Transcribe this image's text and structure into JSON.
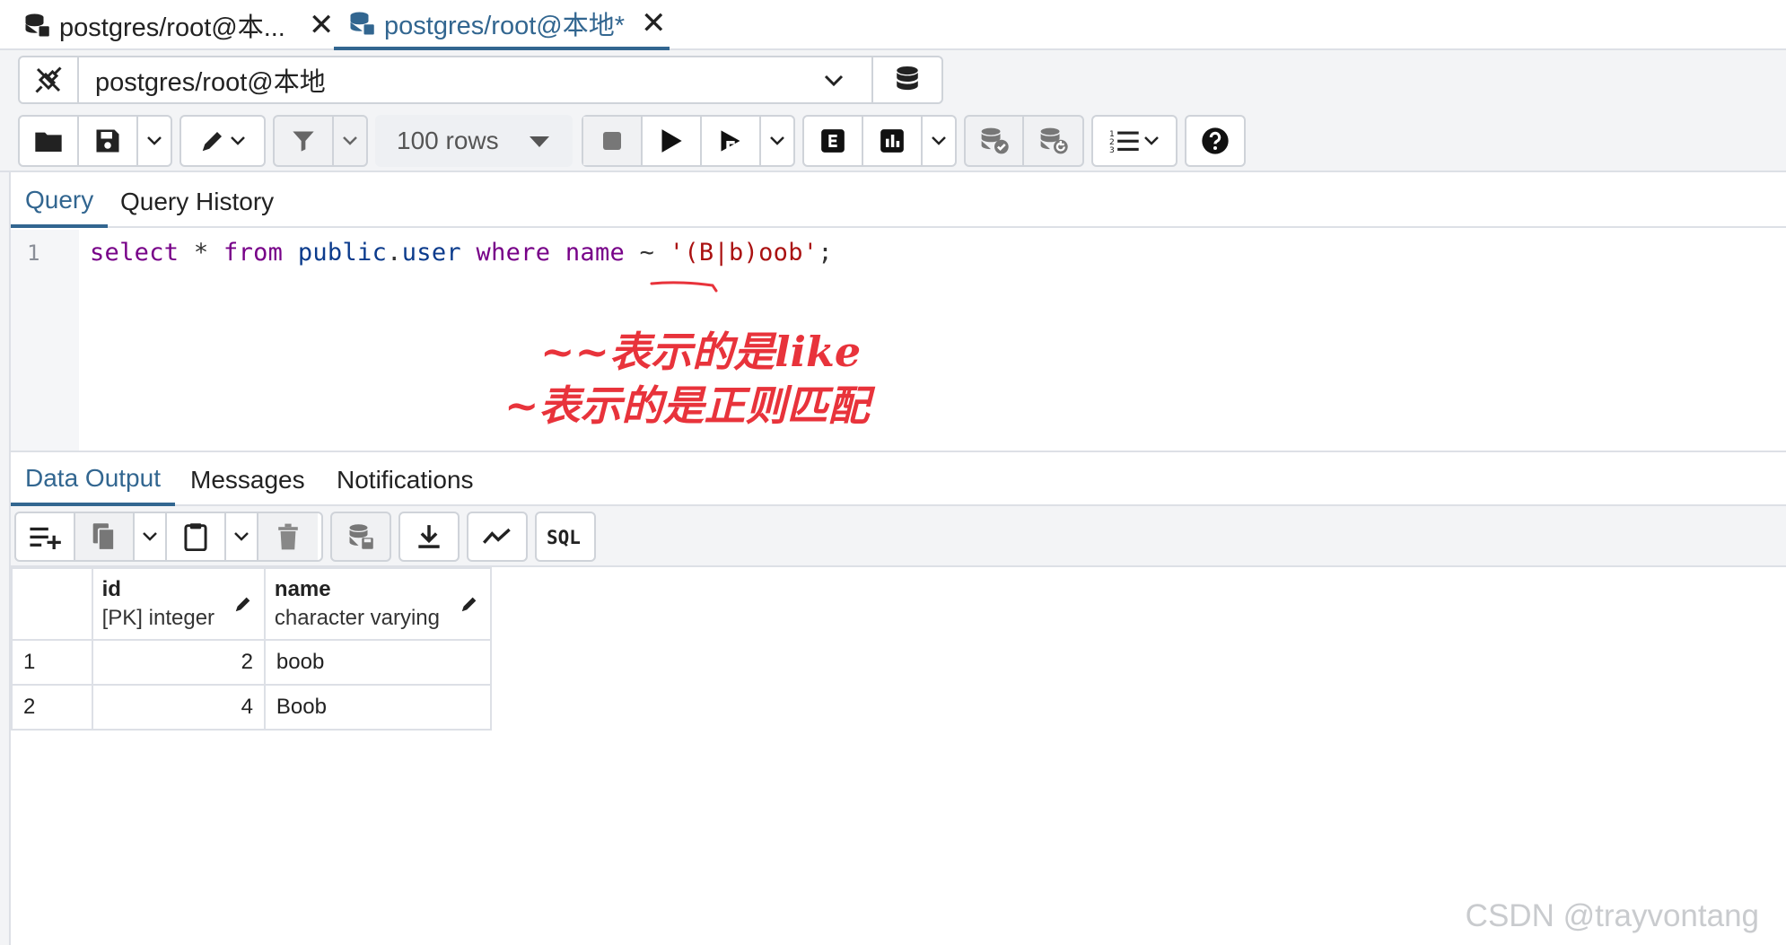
{
  "editor_tabs": [
    {
      "label": "postgres/root@本...",
      "active": false
    },
    {
      "label": "postgres/root@本地*",
      "active": true
    }
  ],
  "connection": {
    "selected": "postgres/root@本地"
  },
  "toolbar": {
    "rows_limit": "100 rows"
  },
  "query_tabs": [
    {
      "label": "Query",
      "active": true
    },
    {
      "label": "Query History",
      "active": false
    }
  ],
  "editor": {
    "line_number": "1",
    "tokens": {
      "select": "select",
      "star": " * ",
      "from": "from",
      "schema": "public",
      "dot": ".",
      "table": "user",
      "where": "where",
      "col": "name",
      "tilde": "~",
      "pattern": "'(B|b)oob'",
      "semi": ";"
    }
  },
  "annotations": {
    "line1": "~~表示的是like",
    "line2": "~表示的是正则匹配"
  },
  "output_tabs": [
    {
      "label": "Data Output",
      "active": true
    },
    {
      "label": "Messages",
      "active": false
    },
    {
      "label": "Notifications",
      "active": false
    }
  ],
  "grid": {
    "columns": [
      {
        "name": "id",
        "type": "[PK] integer"
      },
      {
        "name": "name",
        "type": "character varying"
      }
    ],
    "rows": [
      {
        "row": "1",
        "id": "2",
        "name": "boob"
      },
      {
        "row": "2",
        "id": "4",
        "name": "Boob"
      }
    ]
  },
  "watermark": "CSDN @trayvontang",
  "colors": {
    "accent": "#326690",
    "annotation": "#e8333b",
    "keyword": "#770088",
    "string": "#aa1111"
  }
}
